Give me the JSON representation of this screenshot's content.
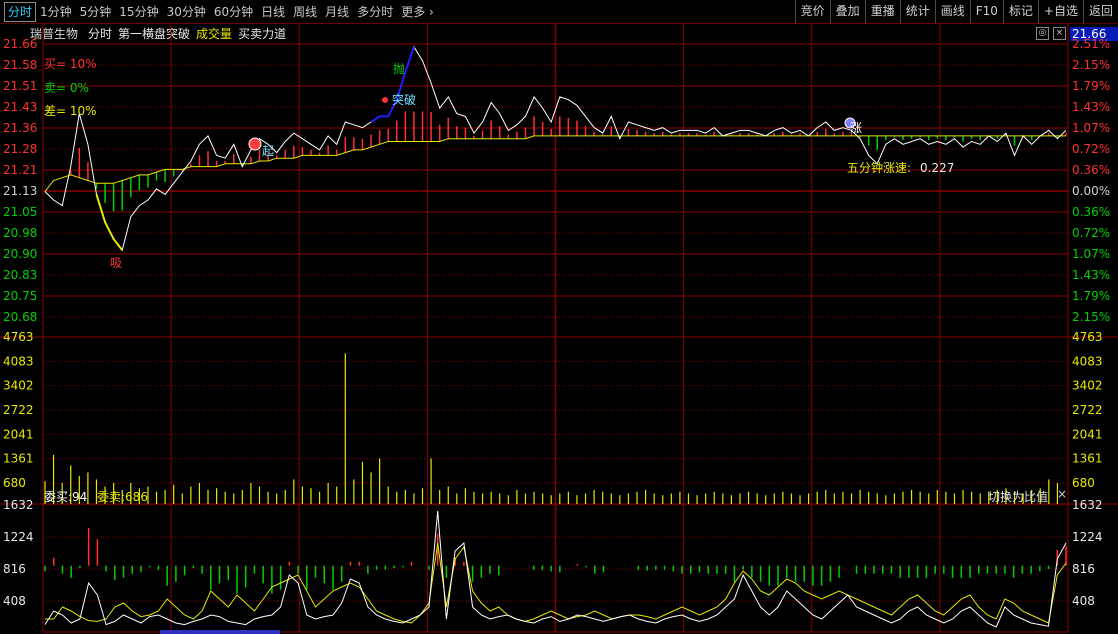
{
  "toolbar": {
    "tabs": [
      "分时",
      "1分钟",
      "5分钟",
      "15分钟",
      "30分钟",
      "60分钟",
      "日线",
      "周线",
      "月线",
      "多分时",
      "更多"
    ],
    "active_tab": "分时",
    "more_arrow": "›",
    "right_buttons": [
      "竞价",
      "叠加",
      "重播",
      "统计",
      "画线",
      "F10",
      "标记",
      "+自选",
      "返回"
    ]
  },
  "infobar": {
    "stock_name": "瑞普生物",
    "mode": "分时",
    "indicator1": "第一横盘突破",
    "indicator2": "成交量",
    "indicator3": "买卖力道",
    "current_price": "21.66"
  },
  "legend": {
    "buy": "买= 10%",
    "sell": "卖= 0%",
    "diff": "差= 10%"
  },
  "annotations": {
    "xi": "吸",
    "qi": "起",
    "pao": "抛",
    "tupo": "突破",
    "zhang": "涨",
    "five_min_label": "五分钟涨速:",
    "five_min_value": "0.227"
  },
  "order_book": {
    "wei_mai_label": "委买:94",
    "wei_mai_color": "#ffffff",
    "wei_sell_label": "委卖:686",
    "switch_label": "切换为比值",
    "close": "×"
  },
  "colors": {
    "grid": "#8a0000",
    "up": "#ff3030",
    "down": "#00d000",
    "price_line": "#ffffff",
    "avg_line": "#e8e800",
    "highlight": "#2020ff"
  },
  "chart_data": [
    {
      "type": "line",
      "title": "分时",
      "y_left_ticks": [
        "21.66",
        "21.58",
        "21.51",
        "21.43",
        "21.36",
        "21.28",
        "21.21",
        "21.13",
        "21.05",
        "20.98",
        "20.90",
        "20.83",
        "20.75",
        "20.68"
      ],
      "y_right_ticks": [
        "2.51%",
        "2.15%",
        "1.79%",
        "1.43%",
        "1.07%",
        "0.72%",
        "0.36%",
        "0.00%",
        "0.36%",
        "0.72%",
        "1.07%",
        "1.43%",
        "1.79%",
        "2.15%"
      ],
      "ylim": [
        20.68,
        21.66
      ],
      "prev_close": 21.13,
      "series": [
        {
          "values": [
            21.13,
            21.1,
            21.08,
            21.22,
            21.41,
            21.3,
            21.12,
            21.02,
            20.96,
            20.92,
            21.04,
            21.08,
            21.1,
            21.14,
            21.12,
            21.16,
            21.2,
            21.24,
            21.3,
            21.33,
            21.26,
            21.25,
            21.3,
            21.22,
            21.28,
            21.32,
            21.3,
            21.27,
            21.31,
            21.34,
            21.32,
            21.3,
            21.28,
            21.33,
            21.3,
            21.38,
            21.37,
            21.36,
            21.38,
            21.4,
            21.4,
            21.46,
            21.56,
            21.65,
            21.6,
            21.52,
            21.43,
            21.47,
            21.41,
            21.4,
            21.34,
            21.38,
            21.45,
            21.41,
            21.35,
            21.37,
            21.4,
            21.47,
            21.43,
            21.38,
            21.47,
            21.46,
            21.44,
            21.4,
            21.36,
            21.34,
            21.4,
            21.32,
            21.38,
            21.37,
            21.36,
            21.35,
            21.36,
            21.34,
            21.35,
            21.35,
            21.35,
            21.34,
            21.36,
            21.33,
            21.34,
            21.35,
            21.35,
            21.34,
            21.33,
            21.35,
            21.36,
            21.34,
            21.35,
            21.33,
            21.36,
            21.38,
            21.35,
            21.36,
            21.35,
            21.32,
            21.26,
            21.23,
            21.3,
            21.32,
            21.3,
            21.31,
            21.32,
            21.3,
            21.31,
            21.3,
            21.32,
            21.29,
            21.31,
            21.3,
            21.33,
            21.31,
            21.34,
            21.26,
            21.33,
            21.3,
            21.33,
            21.35,
            21.32,
            21.35
          ]
        },
        {
          "values": [
            21.13,
            21.17,
            21.18,
            21.19,
            21.18,
            21.17,
            21.16,
            21.16,
            21.16,
            21.17,
            21.18,
            21.19,
            21.19,
            21.2,
            21.21,
            21.21,
            21.21,
            21.22,
            21.22,
            21.22,
            21.22,
            21.23,
            21.23,
            21.23,
            21.23,
            21.24,
            21.24,
            21.25,
            21.25,
            21.25,
            21.26,
            21.26,
            21.26,
            21.26,
            21.26,
            21.27,
            21.28,
            21.28,
            21.29,
            21.3,
            21.31,
            21.31,
            21.31,
            21.31,
            21.31,
            21.31,
            21.31,
            21.32,
            21.32,
            21.32,
            21.32,
            21.32,
            21.32,
            21.32,
            21.32,
            21.32,
            21.32,
            21.33,
            21.33,
            21.33,
            21.33,
            21.33,
            21.33,
            21.33,
            21.33,
            21.33,
            21.33,
            21.33,
            21.33,
            21.33,
            21.33,
            21.33,
            21.33,
            21.33,
            21.33,
            21.33,
            21.33,
            21.33,
            21.33,
            21.33,
            21.33,
            21.33,
            21.33,
            21.33,
            21.33,
            21.33,
            21.33,
            21.33,
            21.33,
            21.33,
            21.33,
            21.33,
            21.33,
            21.33,
            21.33,
            21.33,
            21.33,
            21.33,
            21.33,
            21.33,
            21.33,
            21.33,
            21.33,
            21.33,
            21.33,
            21.33,
            21.33,
            21.33,
            21.33,
            21.33,
            21.33,
            21.33,
            21.33,
            21.33,
            21.33,
            21.33,
            21.33,
            21.33,
            21.33,
            21.33
          ]
        }
      ]
    },
    {
      "type": "bar",
      "title": "成交量",
      "y_ticks": [
        "4763",
        "4083",
        "3402",
        "2722",
        "2041",
        "1361",
        "680"
      ],
      "ylim": [
        0,
        4763
      ],
      "values": [
        650,
        1400,
        600,
        1100,
        800,
        900,
        700,
        500,
        600,
        400,
        600,
        450,
        500,
        350,
        400,
        550,
        300,
        500,
        600,
        400,
        450,
        350,
        300,
        400,
        600,
        500,
        350,
        300,
        400,
        700,
        500,
        450,
        350,
        600,
        500,
        4300,
        700,
        1200,
        900,
        1300,
        500,
        350,
        400,
        300,
        450,
        1300,
        400,
        500,
        300,
        450,
        350,
        300,
        350,
        300,
        250,
        400,
        300,
        350,
        300,
        250,
        300,
        350,
        250,
        300,
        400,
        350,
        300,
        250,
        300,
        350,
        400,
        300,
        250,
        300,
        350,
        300,
        250,
        300,
        350,
        300,
        250,
        300,
        350,
        300,
        250,
        300,
        350,
        300,
        250,
        300,
        350,
        400,
        300,
        350,
        300,
        400,
        350,
        300,
        250,
        300,
        350,
        400,
        350,
        300,
        400,
        350,
        300,
        400,
        350,
        300,
        350,
        400,
        450,
        350,
        300,
        400,
        450,
        700,
        600
      ]
    },
    {
      "type": "line",
      "title": "买卖力道",
      "y_ticks": [
        "1632",
        "1224",
        "816",
        "408"
      ],
      "ylim": [
        0,
        1700
      ],
      "series": [
        {
          "values": [
            80,
            250,
            200,
            100,
            150,
            600,
            450,
            80,
            120,
            200,
            150,
            100,
            180,
            200,
            150,
            100,
            80,
            120,
            150,
            200,
            180,
            120,
            100,
            80,
            150,
            180,
            200,
            300,
            700,
            600,
            200,
            150,
            180,
            200,
            350,
            650,
            600,
            300,
            200,
            150,
            120,
            100,
            150,
            200,
            300,
            1500,
            150,
            1000,
            1100,
            300,
            200,
            150,
            180,
            200,
            150,
            120,
            100,
            150,
            180,
            120,
            150,
            200,
            180,
            150,
            120,
            150,
            180,
            200,
            150,
            120,
            100,
            150,
            180,
            200,
            150,
            120,
            150,
            200,
            300,
            400,
            700,
            500,
            300,
            200,
            300,
            500,
            400,
            300,
            200,
            150,
            250,
            350,
            450,
            300,
            250,
            200,
            150,
            100,
            150,
            250,
            300,
            200,
            150,
            100,
            150,
            250,
            300,
            200,
            100,
            50,
            300,
            200,
            150,
            100,
            80,
            60,
            900,
            1100
          ]
        },
        {
          "values": [
            150,
            150,
            300,
            250,
            180,
            130,
            120,
            150,
            300,
            350,
            250,
            180,
            200,
            250,
            400,
            300,
            200,
            150,
            250,
            500,
            400,
            300,
            450,
            350,
            250,
            400,
            550,
            600,
            650,
            700,
            500,
            300,
            400,
            500,
            550,
            600,
            550,
            400,
            250,
            200,
            150,
            120,
            100,
            200,
            350,
            1100,
            300,
            900,
            1050,
            500,
            350,
            250,
            300,
            200,
            150,
            120,
            150,
            200,
            250,
            200,
            150,
            180,
            200,
            250,
            200,
            150,
            180,
            200,
            200,
            180,
            150,
            200,
            250,
            300,
            250,
            200,
            250,
            300,
            400,
            600,
            750,
            650,
            500,
            450,
            550,
            650,
            600,
            500,
            450,
            400,
            450,
            500,
            450,
            400,
            350,
            300,
            250,
            200,
            300,
            400,
            450,
            350,
            250,
            200,
            300,
            400,
            450,
            300,
            200,
            150,
            400,
            350,
            250,
            200,
            150,
            100,
            700,
            850
          ]
        }
      ]
    }
  ]
}
